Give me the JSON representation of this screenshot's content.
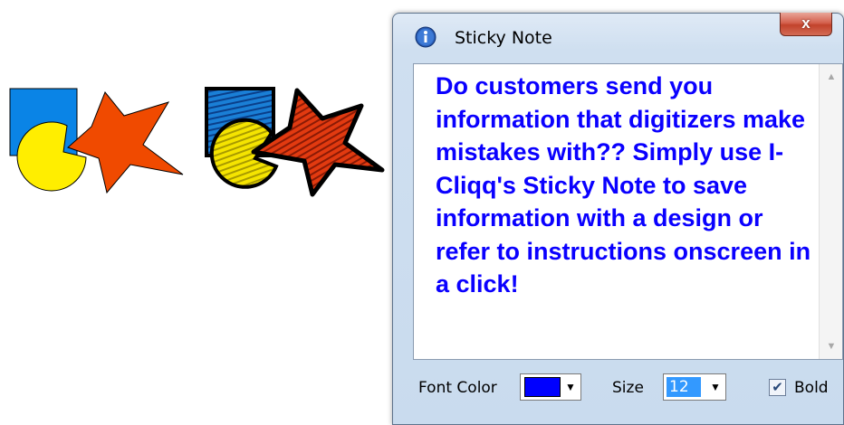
{
  "window": {
    "title": "Sticky Note",
    "close_label": "x"
  },
  "note": {
    "text": "Do customers send you information that digitizers make mistakes with?? Simply use I-Cliqq's Sticky Note to save information with a design or refer to instructions onscreen in a click!",
    "color": "#0a00ff"
  },
  "controls": {
    "font_color_label": "Font Color",
    "font_color_value": "#0000ff",
    "size_label": "Size",
    "size_value": "12",
    "bold_label": "Bold",
    "bold_checked": true
  },
  "icons": {
    "title": "info-icon",
    "close": "close-icon",
    "scroll_up": "scroll-up-arrow-icon",
    "scroll_down": "scroll-down-arrow-icon",
    "dropdown": "chevron-down-icon",
    "check": "checkmark-icon"
  },
  "colors": {
    "square": "#0a84e6",
    "circle": "#ffee00",
    "star": "#f04a00",
    "close_button": "#c9452f"
  }
}
